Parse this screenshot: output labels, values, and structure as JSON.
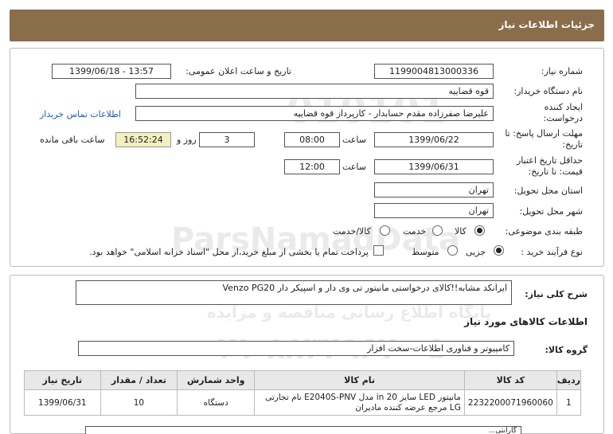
{
  "header": {
    "title": "جزئیات اطلاعات نیاز"
  },
  "form": {
    "need_number_label": "شماره نیاز:",
    "need_number": "1199004813000336",
    "announce_label": "تاریخ و ساعت اعلان عمومی:",
    "announce_value": "1399/06/18 - 13:57",
    "buyer_label": "نام دستگاه خریدار:",
    "buyer_value": "قوه قضاییه",
    "creator_label": "ایجاد کننده درخواست:",
    "creator_value": "علیرضا  صفرزاده مقدم  حسابدار - کارپرداز قوه قضاییه",
    "contact_link": "اطلاعات تماس خریدار",
    "deadline_label": "مهلت ارسال پاسخ: تا تاریخ:",
    "deadline_date": "1399/06/22",
    "time_label": "ساعت",
    "deadline_time": "08:00",
    "days_value": "3",
    "days_label": "روز و",
    "remaining_time": "16:52:24",
    "remaining_label": "ساعت باقی مانده",
    "validity_label": "حداقل تاریخ اعتبار قیمت: تا تاریخ:",
    "validity_date": "1399/06/31",
    "validity_time": "12:00",
    "province_label": "استان محل تحویل:",
    "province_value": "تهران",
    "city_label": "شهر محل تحویل:",
    "city_value": "تهران",
    "category_label": "طبقه بندی موضوعی:",
    "category_options": [
      "کالا",
      "خدمت",
      "کالا/خدمت"
    ],
    "process_label": "نوع فرآیند خرید :",
    "process_options": [
      "جزیی",
      "متوسط"
    ],
    "payment_note": "پرداخت تمام یا بخشی از مبلغ خرید،از محل \"اسناد خزانه اسلامی\" خواهد بود."
  },
  "description": {
    "label": "شرح کلی نیاز:",
    "value": "ایرانکد مشابه!!کالای درخواستی مانیتور تی وی دار و اسپیکر دار Venzo PG20"
  },
  "goods_section": {
    "title": "اطلاعات کالاهای مورد نیاز",
    "group_label": "گروه کالا:",
    "group_value": "کامپیوتر و فناوری اطلاعات-سخت افزار"
  },
  "table": {
    "headers": [
      "ردیف",
      "کد کالا",
      "نام کالا",
      "واحد شمارش",
      "تعداد / مقدار",
      "تاریخ نیاز"
    ],
    "rows": [
      {
        "row": "1",
        "code": "2232200071960060",
        "name": "مانیتور LED سایز 20 in مدل E2040S-PNV نام تجارتی LG مرجع عرضه کننده مادیران",
        "unit": "دستگاه",
        "qty": "10",
        "date": "1399/06/31"
      }
    ]
  },
  "footer_partial": {
    "label": "گارانتی..."
  },
  "watermark": {
    "line1": "ParsNamadData",
    "line2": "پایگاه اطلاع رسانی مناقصه و مزایده",
    "line3": "۰۲۱-۸۸۳۴۹۶۷۰-۵",
    "numbers": "010101"
  }
}
